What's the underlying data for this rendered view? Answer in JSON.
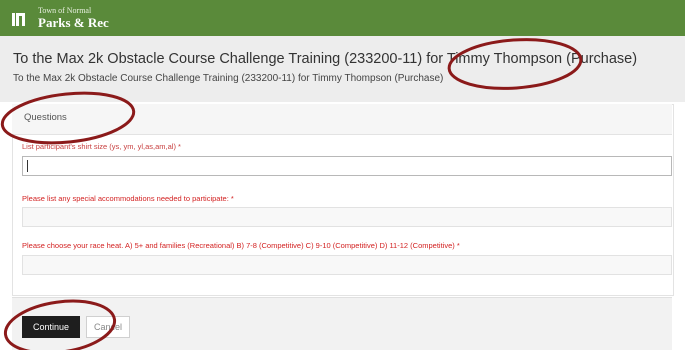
{
  "brand": {
    "org": "Town of Normal",
    "name": "Parks & Rec",
    "header_color": "#5a8a3a"
  },
  "title": {
    "main": "To the Max 2k Obstacle Course Challenge Training (233200-11) for Timmy Thompson (Purchase)",
    "sub": "To the Max 2k Obstacle Course Challenge Training (233200-11) for Timmy Thompson (Purchase)"
  },
  "questions": {
    "heading": "Questions",
    "items": [
      {
        "label": "List participant's shirt size (ys, ym, yl,as,am,al) *",
        "value": ""
      },
      {
        "label": "Please list any special accommodations needed to participate: *",
        "value": ""
      },
      {
        "label": "Please choose your race heat. A) 5+ and families (Recreational) B) 7-8 (Competitive) C) 9-10 (Competitive) D) 11-12 (Competitive) *",
        "value": ""
      }
    ]
  },
  "actions": {
    "continue": "Continue",
    "cancel": "Cancel"
  },
  "colors": {
    "required_label": "#d32222",
    "annotation": "#8b1a1a"
  }
}
